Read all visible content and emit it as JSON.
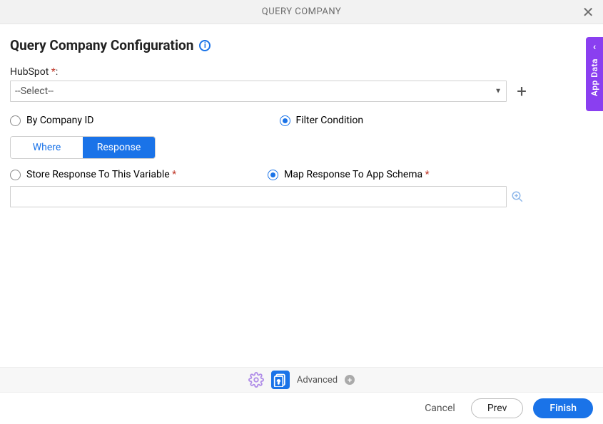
{
  "header": {
    "title": "QUERY COMPANY"
  },
  "page_title": "Query Company Configuration",
  "hubspot": {
    "label": "HubSpot",
    "select_placeholder": "--Select--"
  },
  "radios": {
    "by_company_id": "By Company ID",
    "filter_condition": "Filter Condition",
    "store_response": "Store Response To This Variable",
    "map_response": "Map Response To App Schema"
  },
  "segmented": {
    "where": "Where",
    "response": "Response"
  },
  "toolbar": {
    "advanced": "Advanced"
  },
  "footer": {
    "cancel": "Cancel",
    "prev": "Prev",
    "finish": "Finish"
  },
  "side_tab": {
    "label": "App Data"
  }
}
